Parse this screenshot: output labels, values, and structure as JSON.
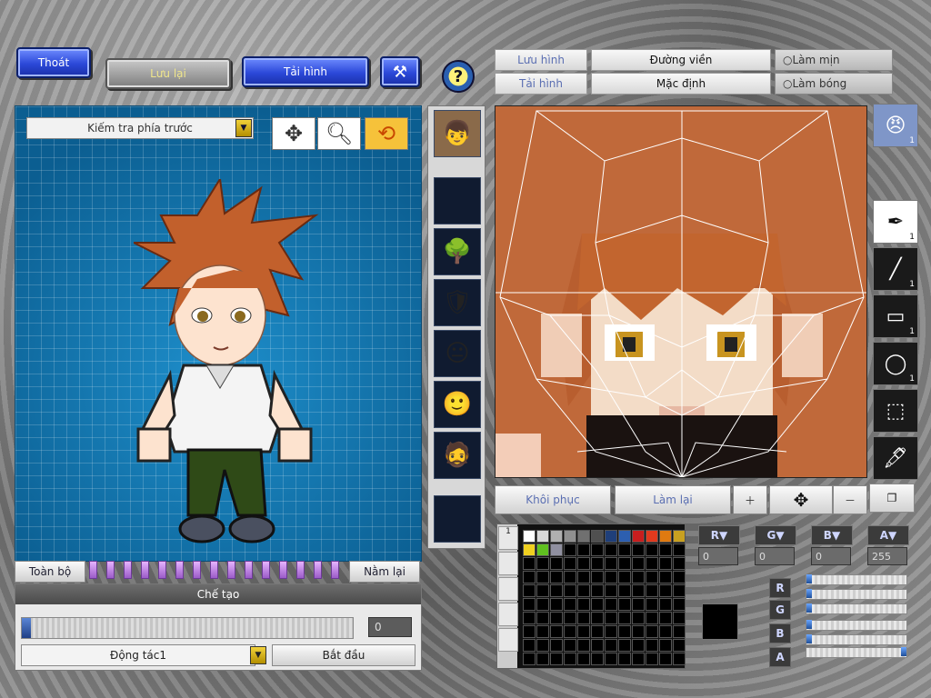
{
  "top": {
    "exit": "Thoát",
    "save": "Lưu lại",
    "reload": "Tải hình",
    "help": "?"
  },
  "left": {
    "view_select": "Kiếm tra phía trước",
    "all_button": "Toàn bộ",
    "lie_button": "Nằm lại",
    "make_header": "Chế tạo",
    "progress_value": "0",
    "motion_select": "Động tác1",
    "start_button": "Bắt đầu",
    "progress_fraction": 0
  },
  "editor": {
    "tab_save": "Lưu hình",
    "tab_load": "Tải hình",
    "tab_outline": "Đường viền",
    "tab_default": "Mặc định",
    "radio_smooth": "Làm mịn",
    "radio_shade": "Làm bóng",
    "restore_button": "Khôi phục",
    "redo_button": "Làm lại",
    "tool_counts": [
      "1",
      "1",
      "1",
      "1"
    ],
    "face_count": "1"
  },
  "color": {
    "r_label": "R",
    "g_label": "G",
    "b_label": "B",
    "a_label": "A",
    "r_value": "0",
    "g_value": "0",
    "b_value": "0",
    "a_value": "255",
    "current": "#000000",
    "palette": [
      "#ffffff",
      "#d8d8d8",
      "#b0b0b0",
      "#909090",
      "#707070",
      "#505050",
      "#1f3f7a",
      "#2d5fb0",
      "#c81e1e",
      "#e03a1e",
      "#e07a10",
      "#c8a020",
      "#f0d020",
      "#60c020",
      "#9090a0"
    ]
  }
}
